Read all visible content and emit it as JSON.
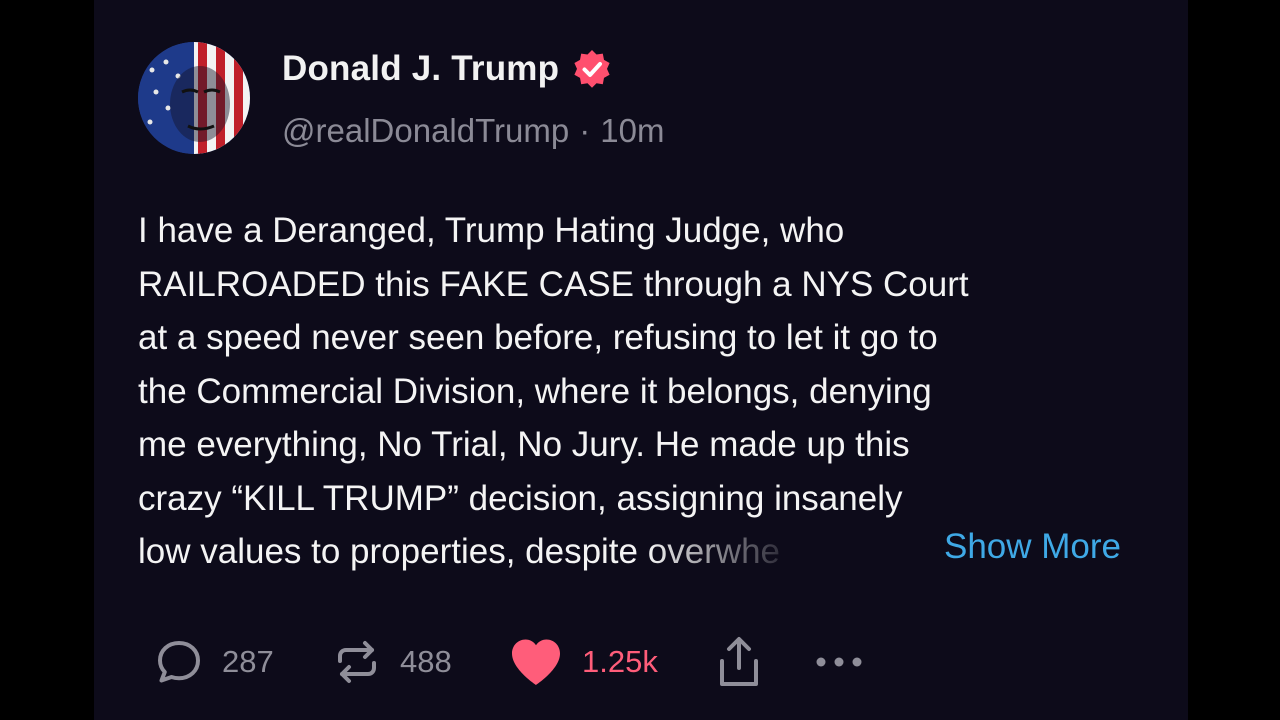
{
  "post": {
    "author": {
      "display_name": "Donald J. Trump",
      "handle": "@realDonaldTrump",
      "separator": "·",
      "time": "10m",
      "verified_color": "#ff4f6e"
    },
    "body_lines": [
      "I have a Deranged, Trump Hating Judge, who",
      "RAILROADED this FAKE CASE through a NYS Court",
      "at a speed never seen before, refusing to let it go to",
      "the Commercial Division, where it belongs, denying",
      "me everything, No Trial, No Jury. He made up this",
      "crazy “KILL TRUMP” decision, assigning insanely"
    ],
    "last_line": {
      "text": "low values to properties, despite ",
      "faded": "overwhe"
    },
    "show_more_label": "Show More",
    "actions": {
      "reply_count": "287",
      "repost_count": "488",
      "like_count": "1.25k"
    }
  },
  "colors": {
    "background": "#0d0b1a",
    "text": "#f4f4f4",
    "muted": "#8b8a96",
    "link": "#3fa9e6",
    "like": "#ff5d7a"
  },
  "icons": {
    "avatar": "flag-portrait-avatar",
    "verified": "verified-badge-icon",
    "reply": "reply-bubble-icon",
    "repost": "repost-arrows-icon",
    "like": "heart-icon",
    "share": "share-upload-icon",
    "more": "more-dots-icon"
  }
}
